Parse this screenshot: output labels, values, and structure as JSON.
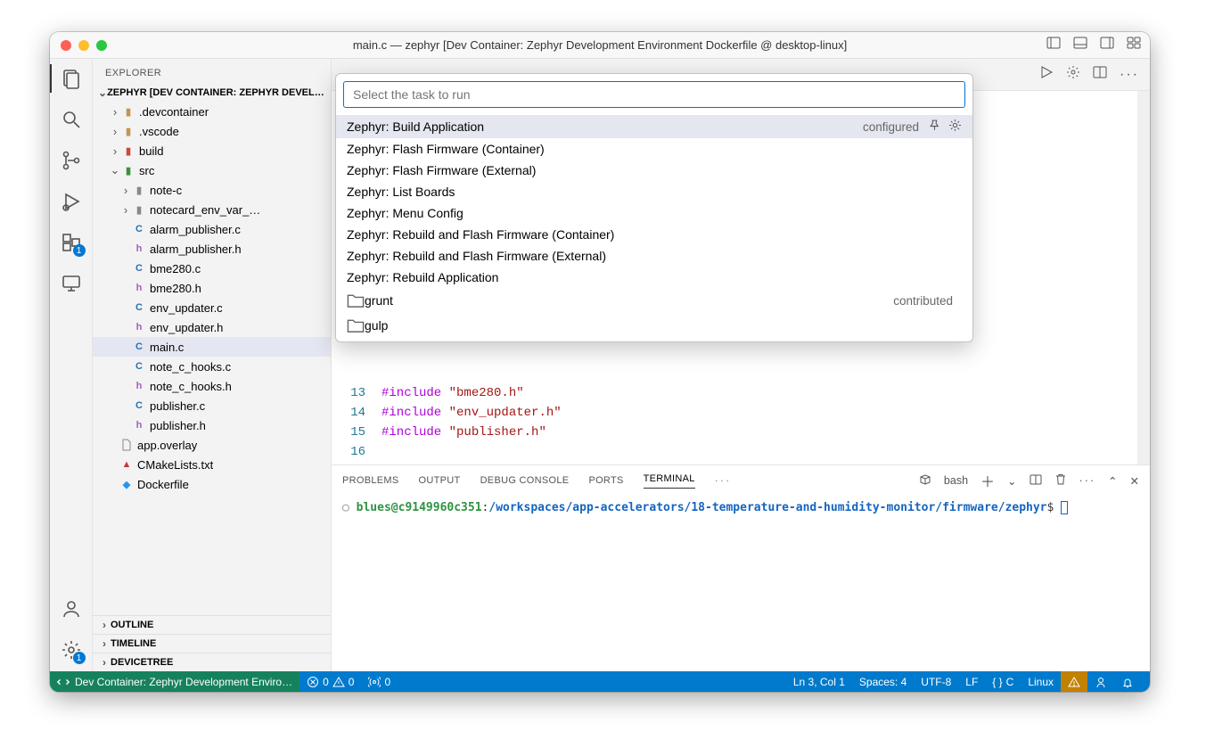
{
  "window": {
    "title": "main.c — zephyr [Dev Container: Zephyr Development Environment Dockerfile @ desktop-linux]"
  },
  "activitybar": {
    "badges": {
      "extensions": "1",
      "settings": "1"
    }
  },
  "sidebar": {
    "title": "EXPLORER",
    "root": "ZEPHYR [DEV CONTAINER: ZEPHYR DEVELOPMENT ENVIRONMENT DOCKERFILE @ DESKTOP-LINUX]",
    "tree": {
      "devcontainer": ".devcontainer",
      "vscode": ".vscode",
      "build": "build",
      "src": "src",
      "note_c": "note-c",
      "env_var": "notecard_env_var_…",
      "alarm_pub_c": "alarm_publisher.c",
      "alarm_pub_h": "alarm_publisher.h",
      "bme280_c": "bme280.c",
      "bme280_h": "bme280.h",
      "env_upd_c": "env_updater.c",
      "env_upd_h": "env_updater.h",
      "main_c": "main.c",
      "hooks_c": "note_c_hooks.c",
      "hooks_h": "note_c_hooks.h",
      "pub_c": "publisher.c",
      "pub_h": "publisher.h",
      "overlay": "app.overlay",
      "cmake": "CMakeLists.txt",
      "docker": "Dockerfile"
    },
    "sections": {
      "outline": "OUTLINE",
      "timeline": "TIMELINE",
      "devicetree": "DEVICETREE"
    }
  },
  "editor": {
    "includes": {
      "l13": "\"bme280.h\"",
      "l14": "\"env_updater.h\"",
      "l15": "\"publisher.h\""
    },
    "include_kw": "#include",
    "lines": {
      "l13": "13",
      "l14": "14",
      "l15": "15",
      "l16": "16"
    }
  },
  "quickpick": {
    "placeholder": "Select the task to run",
    "items": [
      {
        "label": "Zephyr: Build Application",
        "extra": "configured",
        "selected": true,
        "pin": true
      },
      {
        "label": "Zephyr: Flash Firmware (Container)"
      },
      {
        "label": "Zephyr: Flash Firmware (External)"
      },
      {
        "label": "Zephyr: List Boards"
      },
      {
        "label": "Zephyr: Menu Config"
      },
      {
        "label": "Zephyr: Rebuild and Flash Firmware (Container)"
      },
      {
        "label": "Zephyr: Rebuild and Flash Firmware (External)"
      },
      {
        "label": "Zephyr: Rebuild Application"
      },
      {
        "label": "grunt",
        "extra": "contributed",
        "folder": true
      },
      {
        "label": "gulp",
        "folder": true
      }
    ]
  },
  "panel": {
    "tabs": {
      "problems": "PROBLEMS",
      "output": "OUTPUT",
      "debug": "DEBUG CONSOLE",
      "ports": "PORTS",
      "terminal": "TERMINAL"
    },
    "shell": "bash",
    "prompt": {
      "user": "blues@c9149960c351",
      "sep": ":",
      "path": "/workspaces/app-accelerators/18-temperature-and-humidity-monitor/firmware/zephyr",
      "sigil": "$"
    }
  },
  "statusbar": {
    "remote": "Dev Container: Zephyr Development Enviro…",
    "errors": "0",
    "warnings": "0",
    "ports": "0",
    "linecol": "Ln 3, Col 1",
    "spaces": "Spaces: 4",
    "encoding": "UTF-8",
    "eol": "LF",
    "lang": "C",
    "os": "Linux"
  }
}
